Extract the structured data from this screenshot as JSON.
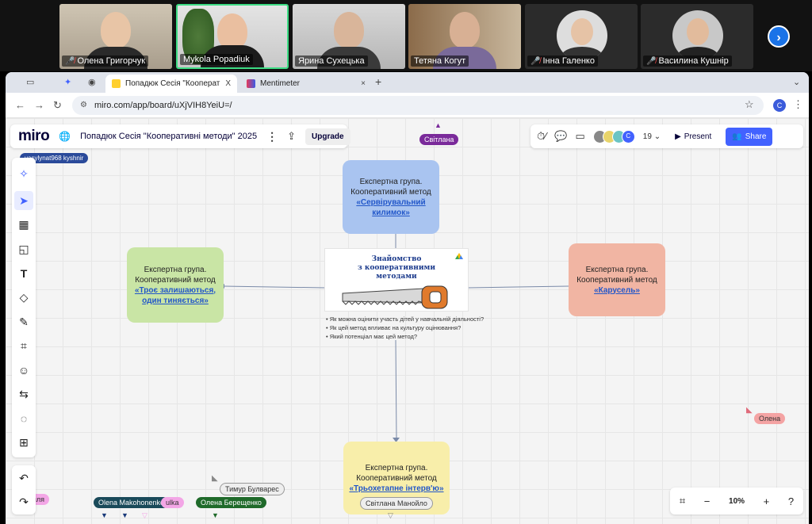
{
  "participants": [
    {
      "name": "Олена Григорчук",
      "muted": true,
      "active": false
    },
    {
      "name": "Mykola Popadiuk",
      "muted": false,
      "active": true
    },
    {
      "name": "Ярина Сухецька",
      "muted": false,
      "active": false
    },
    {
      "name": "Тетяна Когут",
      "muted": false,
      "active": false
    },
    {
      "name": "Інна Галенко",
      "muted": true,
      "active": false
    },
    {
      "name": "Василина Кушнір",
      "muted": true,
      "active": false
    }
  ],
  "browser": {
    "tabs": [
      {
        "label": "Попадюк Сесія \"Кооперативн\"",
        "close": "X"
      },
      {
        "label": "Mentimeter",
        "close": "×"
      }
    ],
    "new_tab": "+",
    "url": "miro.com/app/board/uXjVIH8YeiU=/",
    "profile_initial": "C"
  },
  "miro": {
    "logo": "miro",
    "board_title": "Попадюк Сесія \"Кооперативні методи\" 2025",
    "upgrade_label": "Upgrade",
    "participant_count": "19",
    "present_label": "Present",
    "share_label": "Share",
    "zoom": "10%",
    "avatar_letter": "C"
  },
  "cards": {
    "top": {
      "line1": "Експертна група.",
      "line2": "Кооперативний метод",
      "link": "«Сервірувальний килимок»"
    },
    "left": {
      "line1": "Експертна група.",
      "line2": "Кооперативний метод",
      "link": "«Троє залишаються, один тиняється»"
    },
    "right": {
      "line1": "Експертна група.",
      "line2": "Кооперативний метод",
      "link": "«Карусель»"
    },
    "bottom": {
      "line1": "Експертна група.",
      "line2": "Кооперативний метод",
      "link": "«Трьохетапне інтерв'ю»"
    }
  },
  "center": {
    "title_line1": "Знайомство",
    "title_line2": "з кооперативними",
    "title_line3": "методами",
    "questions": [
      "Як можна оцінити участь дітей у навчальній діяльності?",
      "Як цей метод впливає на культуру оцінювання?",
      "Який потенціал має цей метод?"
    ]
  },
  "cursors": {
    "svitlana_top": "Світлана",
    "vasylyna": "vasylynat968 kyshnir",
    "olena_right": "Олена",
    "tymur": "Тимур Булварес",
    "svitlana_bottom": "Світлана Манойло",
    "olena_mak": "Olena Makohonenko",
    "ulka": "ulka",
    "olena_ber": "Олена Берещенко",
    "yalia": "яля"
  },
  "colors": {
    "accent": "#4262ff",
    "card_blue": "#a9c4f0",
    "card_green": "#c9e5a5",
    "card_red": "#f1b5a3",
    "card_yellow": "#f8eeaa"
  }
}
